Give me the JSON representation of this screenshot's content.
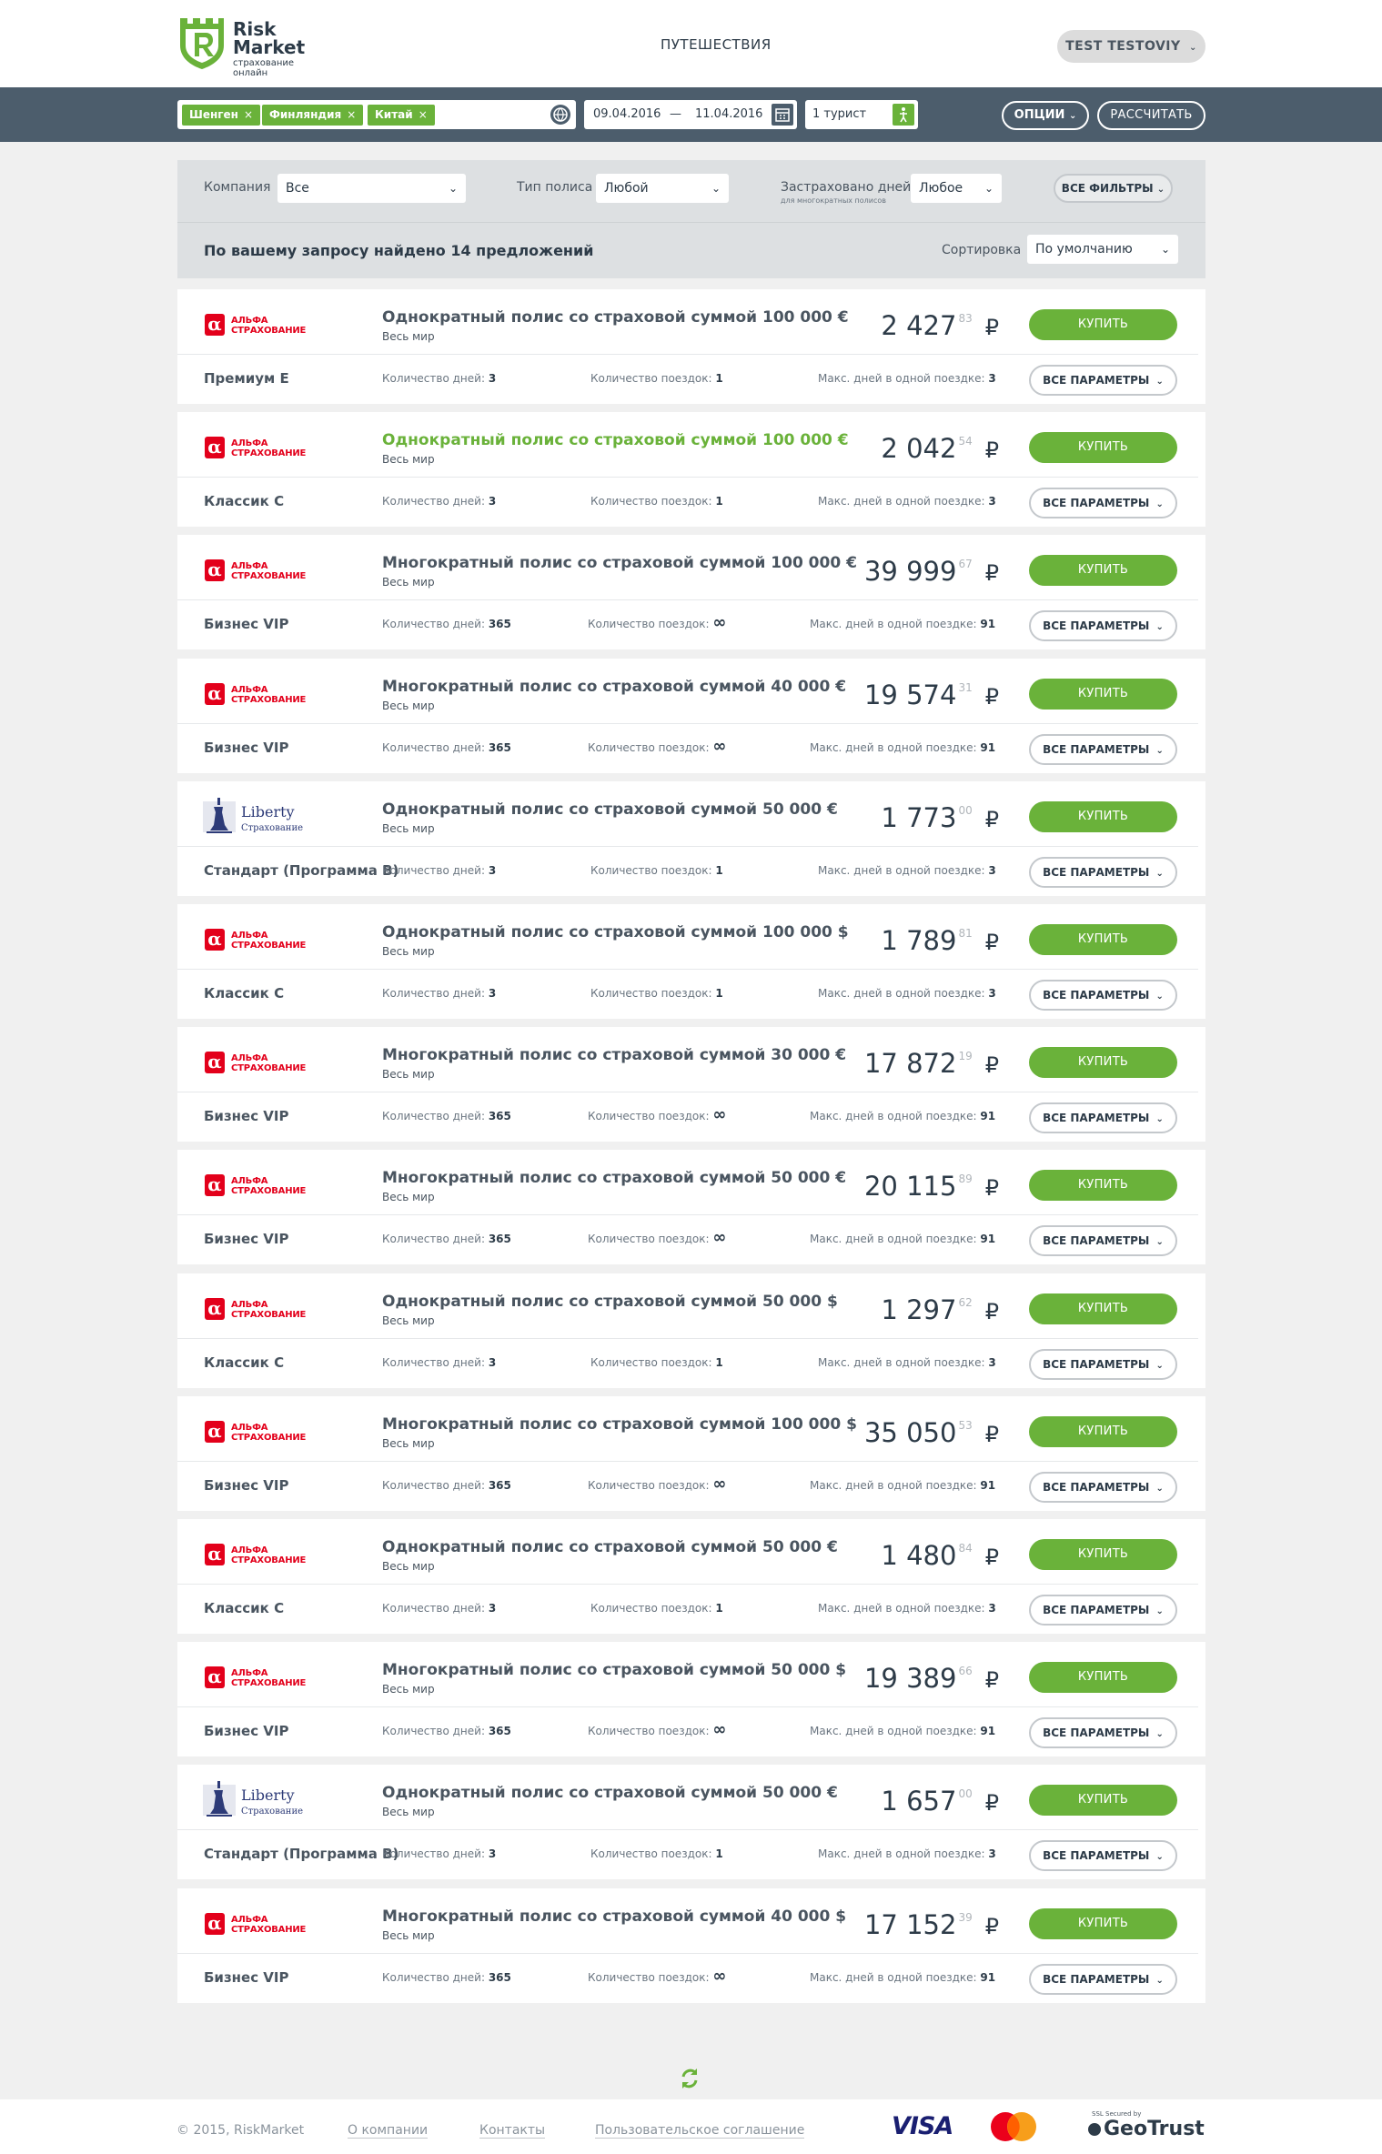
{
  "header": {
    "logo_line1": "Risk",
    "logo_line2": "Market",
    "logo_sub1": "страхование",
    "logo_sub2": "онлайн",
    "nav_travel": "ПУТЕШЕСТВИЯ",
    "user": "TEST TESTOVIY"
  },
  "search": {
    "tags": [
      "Шенген",
      "Финляндия",
      "Китай"
    ],
    "tag_remove": "×",
    "date_from": "09.04.2016",
    "date_sep": "—",
    "date_to": "11.04.2016",
    "tourists": "1 турист",
    "options_label": "ОПЦИИ",
    "calc_label": "РАССЧИТАТЬ"
  },
  "filters": {
    "company_label": "Компания",
    "company_value": "Все",
    "policy_label": "Тип полиса",
    "policy_value": "Любой",
    "days_label": "Застраховано дней",
    "days_sublabel": "для многократных полисов",
    "days_value": "Любое",
    "all_filters": "ВСЕ ФИЛЬТРЫ",
    "found_text": "По вашему запросу найдено 14 предложений",
    "sort_label": "Сортировка",
    "sort_value": "По умолчанию"
  },
  "labels": {
    "buy": "КУПИТЬ",
    "params": "ВСЕ ПАРАМЕТРЫ",
    "days": "Количество дней:",
    "trips": "Количество поездок:",
    "max_days": "Макс. дней в одной поездке:",
    "currency": "₽",
    "alfa_line1": "АЛЬФА",
    "alfa_line2": "СТРАХОВАНИЕ",
    "liberty_line1": "Liberty",
    "liberty_line2": "Страхование",
    "infinity": "∞"
  },
  "offers": [
    {
      "company": "alfa",
      "title": "Однократный полис со страховой суммой 100 000 €",
      "highlight": false,
      "region": "Весь мир",
      "price": "2 427",
      "cents": "83",
      "program": "Премиум E",
      "days": "3",
      "trips": "1",
      "max_days": "3"
    },
    {
      "company": "alfa",
      "title": "Однократный полис со страховой суммой 100 000 €",
      "highlight": true,
      "region": "Весь мир",
      "price": "2 042",
      "cents": "54",
      "program": "Классик C",
      "days": "3",
      "trips": "1",
      "max_days": "3"
    },
    {
      "company": "alfa",
      "title": "Многократный полис со страховой суммой 100 000 €",
      "highlight": false,
      "region": "Весь мир",
      "price": "39 999",
      "cents": "67",
      "program": "Бизнес VIP",
      "days": "365",
      "trips": "∞",
      "max_days": "91"
    },
    {
      "company": "alfa",
      "title": "Многократный полис со страховой суммой 40 000 €",
      "highlight": false,
      "region": "Весь мир",
      "price": "19 574",
      "cents": "31",
      "program": "Бизнес VIP",
      "days": "365",
      "trips": "∞",
      "max_days": "91"
    },
    {
      "company": "liberty",
      "title": "Однократный полис со страховой суммой 50 000 €",
      "highlight": false,
      "region": "Весь мир",
      "price": "1 773",
      "cents": "00",
      "program": "Стандарт (Программа B)",
      "days": "3",
      "trips": "1",
      "max_days": "3"
    },
    {
      "company": "alfa",
      "title": "Однократный полис со страховой суммой 100 000 $",
      "highlight": false,
      "region": "Весь мир",
      "price": "1 789",
      "cents": "81",
      "program": "Классик C",
      "days": "3",
      "trips": "1",
      "max_days": "3"
    },
    {
      "company": "alfa",
      "title": "Многократный полис со страховой суммой 30 000 €",
      "highlight": false,
      "region": "Весь мир",
      "price": "17 872",
      "cents": "19",
      "program": "Бизнес VIP",
      "days": "365",
      "trips": "∞",
      "max_days": "91"
    },
    {
      "company": "alfa",
      "title": "Многократный полис со страховой суммой 50 000 €",
      "highlight": false,
      "region": "Весь мир",
      "price": "20 115",
      "cents": "89",
      "program": "Бизнес VIP",
      "days": "365",
      "trips": "∞",
      "max_days": "91"
    },
    {
      "company": "alfa",
      "title": "Однократный полис со страховой суммой 50 000 $",
      "highlight": false,
      "region": "Весь мир",
      "price": "1 297",
      "cents": "62",
      "program": "Классик C",
      "days": "3",
      "trips": "1",
      "max_days": "3"
    },
    {
      "company": "alfa",
      "title": "Многократный полис со страховой суммой 100 000 $",
      "highlight": false,
      "region": "Весь мир",
      "price": "35 050",
      "cents": "53",
      "program": "Бизнес VIP",
      "days": "365",
      "trips": "∞",
      "max_days": "91"
    },
    {
      "company": "alfa",
      "title": "Однократный полис со страховой суммой 50 000 €",
      "highlight": false,
      "region": "Весь мир",
      "price": "1 480",
      "cents": "84",
      "program": "Классик C",
      "days": "3",
      "trips": "1",
      "max_days": "3"
    },
    {
      "company": "alfa",
      "title": "Многократный полис со страховой суммой 50 000 $",
      "highlight": false,
      "region": "Весь мир",
      "price": "19 389",
      "cents": "66",
      "program": "Бизнес VIP",
      "days": "365",
      "trips": "∞",
      "max_days": "91"
    },
    {
      "company": "liberty",
      "title": "Однократный полис со страховой суммой 50 000 €",
      "highlight": false,
      "region": "Весь мир",
      "price": "1 657",
      "cents": "00",
      "program": "Стандарт (Программа B)",
      "days": "3",
      "trips": "1",
      "max_days": "3"
    },
    {
      "company": "alfa",
      "title": "Многократный полис со страховой суммой 40 000 $",
      "highlight": false,
      "region": "Весь мир",
      "price": "17 152",
      "cents": "39",
      "program": "Бизнес VIP",
      "days": "365",
      "trips": "∞",
      "max_days": "91"
    }
  ],
  "footer": {
    "copyright": "© 2015, RiskMarket",
    "link_about": "О компании",
    "link_contacts": "Контакты",
    "link_terms": "Пользовательское соглашение",
    "visa": "VISA",
    "mastercard": "MasterCard",
    "geotrust_small": "SSL Secured by",
    "geotrust": "GeoTrust"
  },
  "colors": {
    "accent": "#6ab23a",
    "dark_bar": "#4c5d6c",
    "alfa_red": "#e3001b"
  },
  "icons": {
    "globe": "globe-icon",
    "calendar": "calendar-icon",
    "tourist": "person-icon",
    "refresh": "refresh-icon",
    "chevron": "chevron-down-icon"
  }
}
